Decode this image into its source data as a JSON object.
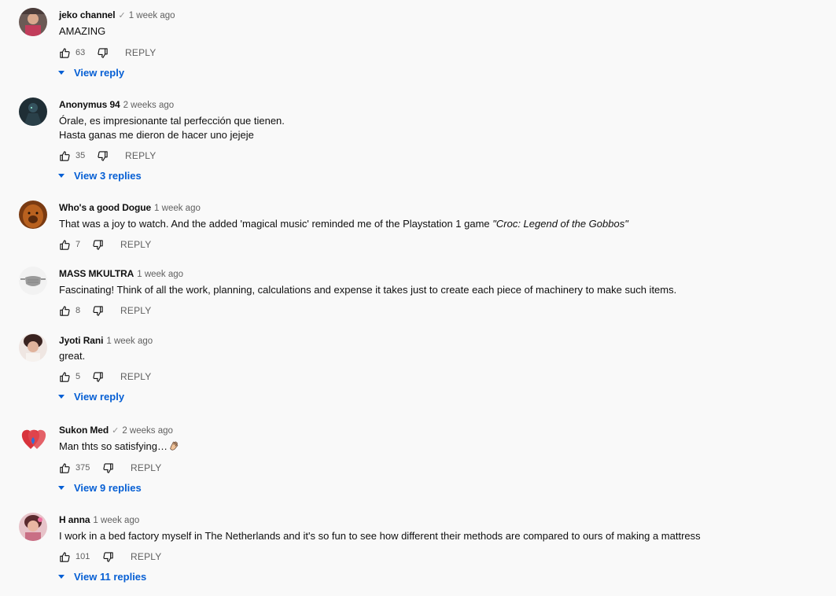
{
  "comments": [
    {
      "author": "jeko channel",
      "verified": true,
      "time": "1 week ago",
      "lines": [
        "AMAZING"
      ],
      "likes": "63",
      "reply_label": "REPLY",
      "replies_label": "View reply"
    },
    {
      "author": "Anonymus 94",
      "verified": false,
      "time": "2 weeks ago",
      "lines": [
        "Órale, es impresionante tal perfección que tienen.",
        "Hasta ganas me dieron de hacer uno jejeje"
      ],
      "likes": "35",
      "reply_label": "REPLY",
      "replies_label": "View 3 replies"
    },
    {
      "author": "Who's a good Dogue",
      "verified": false,
      "time": "1 week ago",
      "text_prefix": "That was a joy to watch.  And the added 'magical music' reminded me of the Playstation 1 game ",
      "text_italic": "\"Croc: Legend of the Gobbos\"",
      "likes": "7",
      "reply_label": "REPLY"
    },
    {
      "author": "MASS MKULTRA",
      "verified": false,
      "time": "1 week ago",
      "lines": [
        "Fascinating! Think of all the work, planning, calculations and expense it takes just to create each piece of machinery to make such items."
      ],
      "likes": "8",
      "reply_label": "REPLY"
    },
    {
      "author": "Jyoti Rani",
      "verified": false,
      "time": "1 week ago",
      "lines": [
        "great."
      ],
      "likes": "5",
      "reply_label": "REPLY",
      "replies_label": "View reply"
    },
    {
      "author": "Sukon Med",
      "verified": true,
      "time": "2 weeks ago",
      "lines": [
        "Man thts so satisfying…"
      ],
      "emoji": "clapping-hand-icon",
      "likes": "375",
      "reply_label": "REPLY",
      "replies_label": "View 9 replies"
    },
    {
      "author": "H anna",
      "verified": false,
      "time": "1 week ago",
      "lines": [
        "I work in a bed factory myself in The Netherlands and it's so fun to see how different their methods are compared to ours of making a mattress"
      ],
      "likes": "101",
      "reply_label": "REPLY",
      "replies_label": "View 11 replies"
    }
  ],
  "icons": {
    "like": "thumb-up-icon",
    "dislike": "thumb-down-icon",
    "verified": "check-icon",
    "expand": "caret-down-icon"
  },
  "colors": {
    "link": "#065fd4",
    "meta": "#606060",
    "background": "#f9f9f9"
  }
}
